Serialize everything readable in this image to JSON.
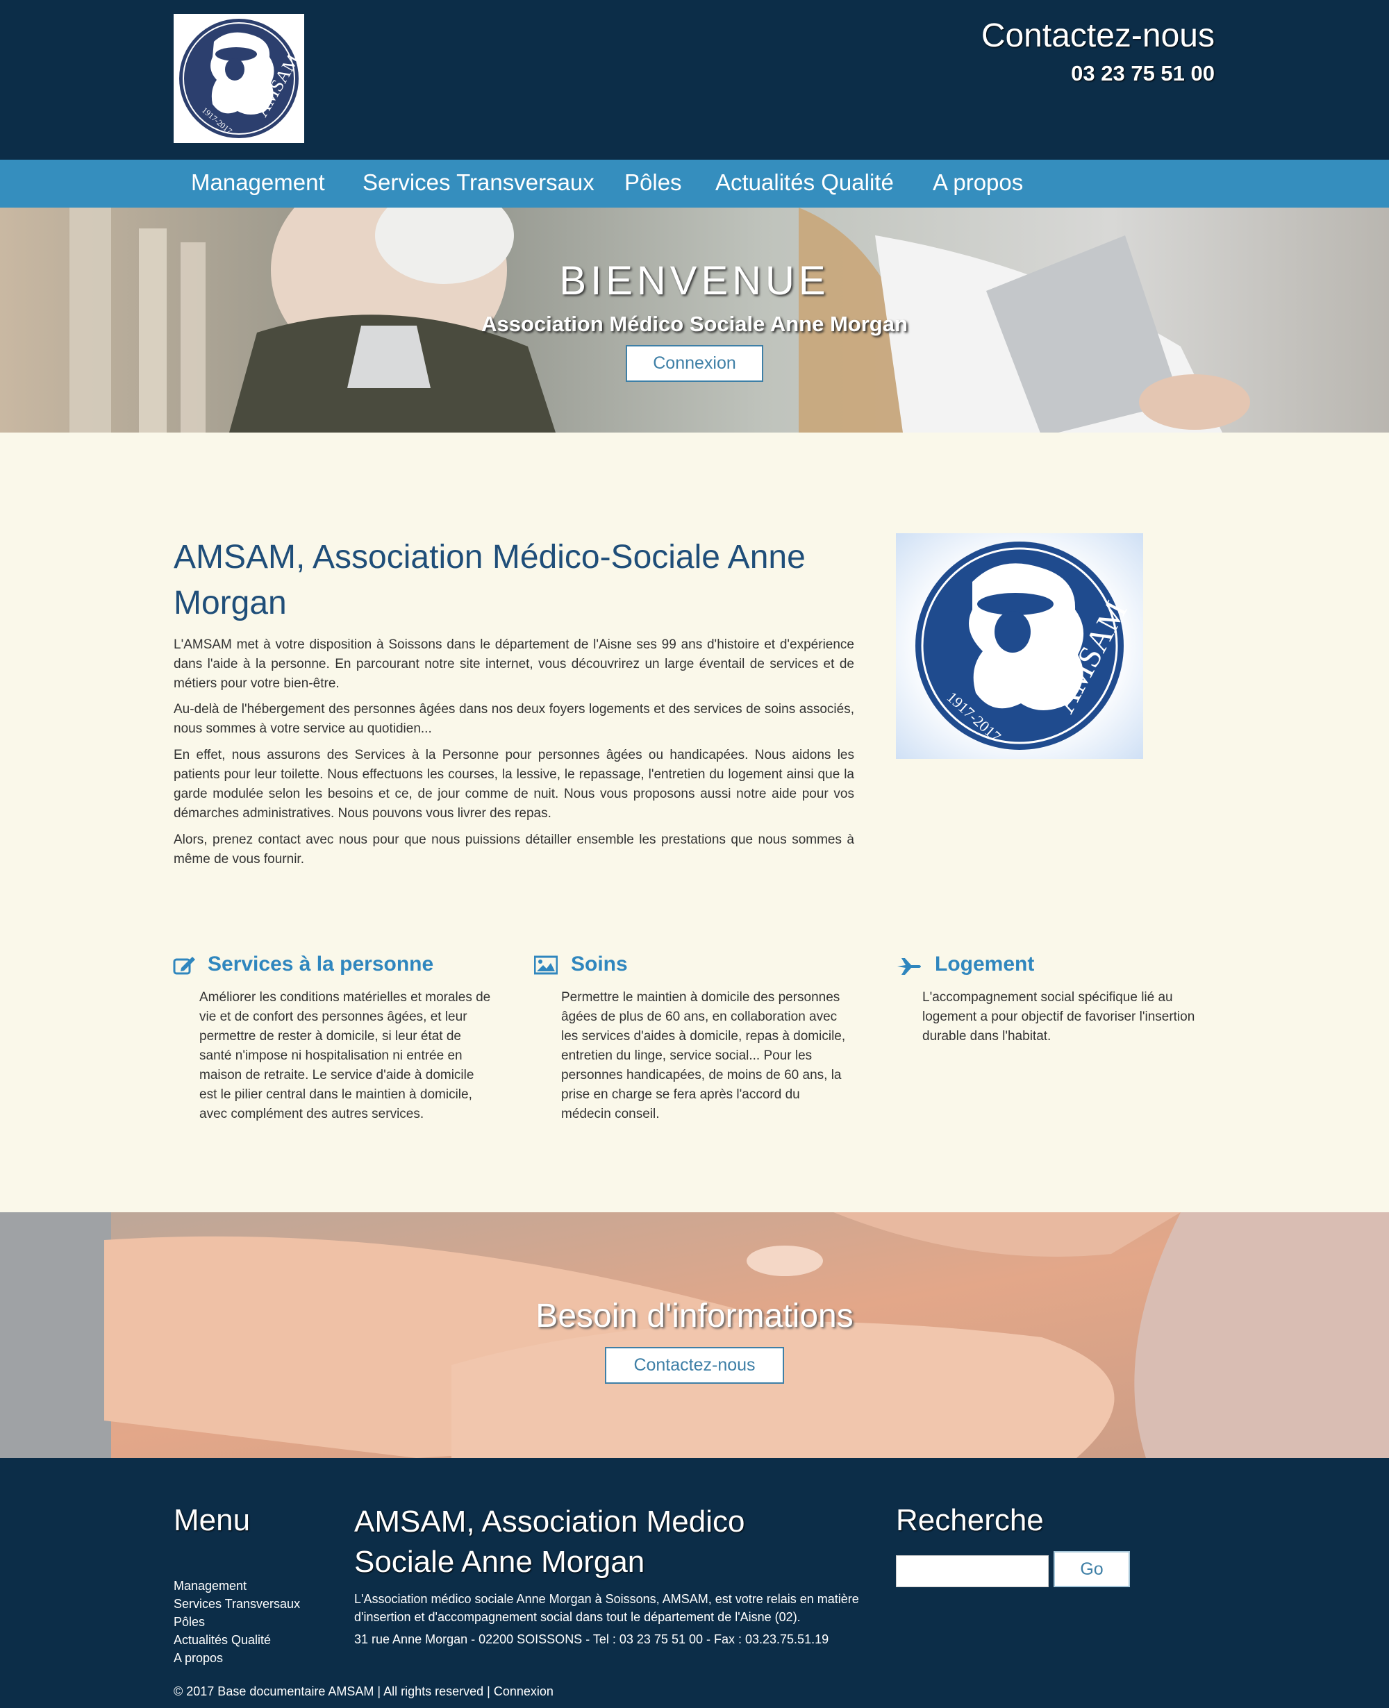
{
  "header": {
    "logo_text": "AMSAM",
    "logo_years": "1917-2017",
    "contact_title": "Contactez-nous",
    "phone": "03 23 75 51 00"
  },
  "nav": {
    "items": [
      {
        "label": "Management"
      },
      {
        "label": "Services Transversaux"
      },
      {
        "label": "Pôles"
      },
      {
        "label": "Actualités Qualité"
      },
      {
        "label": "A propos"
      }
    ]
  },
  "hero": {
    "title": "BIENVENUE",
    "subtitle": "Association Médico Sociale Anne Morgan",
    "button": "Connexion"
  },
  "main": {
    "title": "AMSAM, Association Médico-Sociale Anne Morgan",
    "paragraphs": [
      "L'AMSAM met à votre disposition à Soissons dans le département de l'Aisne ses 99 ans d'histoire et d'expérience dans l'aide à la personne. En parcourant notre site internet, vous découvrirez un large éventail de services et de métiers pour votre bien-être.",
      "Au-delà de l'hébergement des personnes âgées dans nos deux foyers logements et des services de soins associés, nous sommes à votre service au quotidien...",
      "En effet, nous assurons des Services à la Personne pour personnes âgées ou handicapées. Nous aidons les patients pour leur toilette. Nous effectuons les courses, la lessive, le repassage, l'entretien du logement ainsi que la garde modulée selon les besoins et ce, de jour comme de nuit. Nous vous proposons aussi notre aide pour vos démarches administratives. Nous pouvons vous livrer des repas.",
      "Alors, prenez contact avec nous pour que nous puissions détailler ensemble les prestations que nous sommes à même de vous fournir."
    ]
  },
  "features": [
    {
      "title": "Services à la personne",
      "icon": "edit-icon",
      "text": "Améliorer les conditions matérielles et morales de vie et de confort des personnes âgées, et leur permettre de rester à domicile, si leur état de santé n'impose ni hospitalisation ni entrée en maison de retraite. Le service d'aide à domicile est le pilier central dans le maintien à domicile, avec complément des autres services."
    },
    {
      "title": "Soins",
      "icon": "image-icon",
      "text": "Permettre le maintien à domicile des personnes âgées de plus de 60 ans, en collaboration avec les services d'aides à domicile, repas à domicile, entretien du linge, service social... Pour les personnes handicapées, de moins de 60 ans, la prise en charge se fera après l'accord du médecin conseil."
    },
    {
      "title": "Logement",
      "icon": "plane-icon",
      "text": "L'accompagnement social spécifique lié au logement a pour objectif de favoriser l'insertion durable dans l'habitat."
    }
  ],
  "band": {
    "title": "Besoin d'informations",
    "button": "Contactez-nous"
  },
  "footer": {
    "menu_title": "Menu",
    "menu_items": [
      "Management",
      "Services Transversaux",
      "Pôles",
      "Actualités Qualité",
      "A propos"
    ],
    "about_title": "AMSAM, Association Medico Sociale Anne Morgan",
    "about_text": "L'Association médico sociale Anne Morgan à Soissons, AMSAM, est votre relais en matière d'insertion et d'accompagnement social dans tout le département de l'Aisne (02).",
    "address": "31 rue Anne Morgan - 02200 SOISSONS - Tel : 03 23 75 51 00 - Fax : 03.23.75.51.19",
    "search_title": "Recherche",
    "search_value": "",
    "search_button": "Go",
    "copyright": "© 2017 Base documentaire AMSAM | All rights reserved | Connexion"
  },
  "colors": {
    "header_bg": "#0c2d48",
    "nav_bg": "#358ebe",
    "content_bg": "#faf8ea",
    "accent": "#2f86be",
    "title": "#1f4e79"
  }
}
